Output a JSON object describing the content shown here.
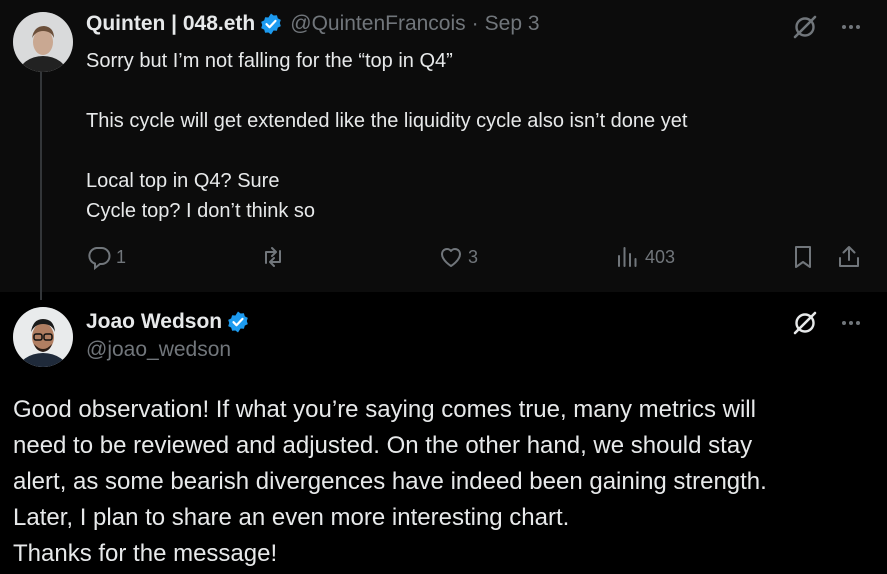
{
  "tweet1": {
    "name": "Quinten | 048.eth",
    "handle": "@QuintenFrancois",
    "date": "Sep 3",
    "separator": "·",
    "lines": [
      "Sorry but I’m not falling for the “top in Q4”",
      "",
      "This cycle will get extended like the liquidity cycle also isn’t done yet",
      "",
      "Local top in Q4? Sure",
      "Cycle top? I don’t think so"
    ],
    "replies": "1",
    "retweets": "",
    "likes": "3",
    "views": "403"
  },
  "tweet2": {
    "name": "Joao Wedson",
    "handle": "@joao_wedson",
    "lines": [
      "Good observation! If what you’re saying comes true, many metrics will",
      "need to be reviewed and adjusted. On the other hand, we should stay",
      "alert, as some bearish divergences have indeed been gaining strength.",
      "Later, I plan to share an even more interesting chart.",
      "Thanks for the message!"
    ]
  },
  "icons": {
    "verified": "verified-badge-icon",
    "grok": "grok-icon",
    "more": "more-icon",
    "reply": "reply-icon",
    "retweet": "retweet-icon",
    "like": "like-icon",
    "views": "views-icon",
    "bookmark": "bookmark-icon",
    "share": "share-icon"
  },
  "colors": {
    "background": "#000000",
    "text": "#e7e9ea",
    "secondary": "#71767b",
    "verified": "#1d9bf0"
  }
}
